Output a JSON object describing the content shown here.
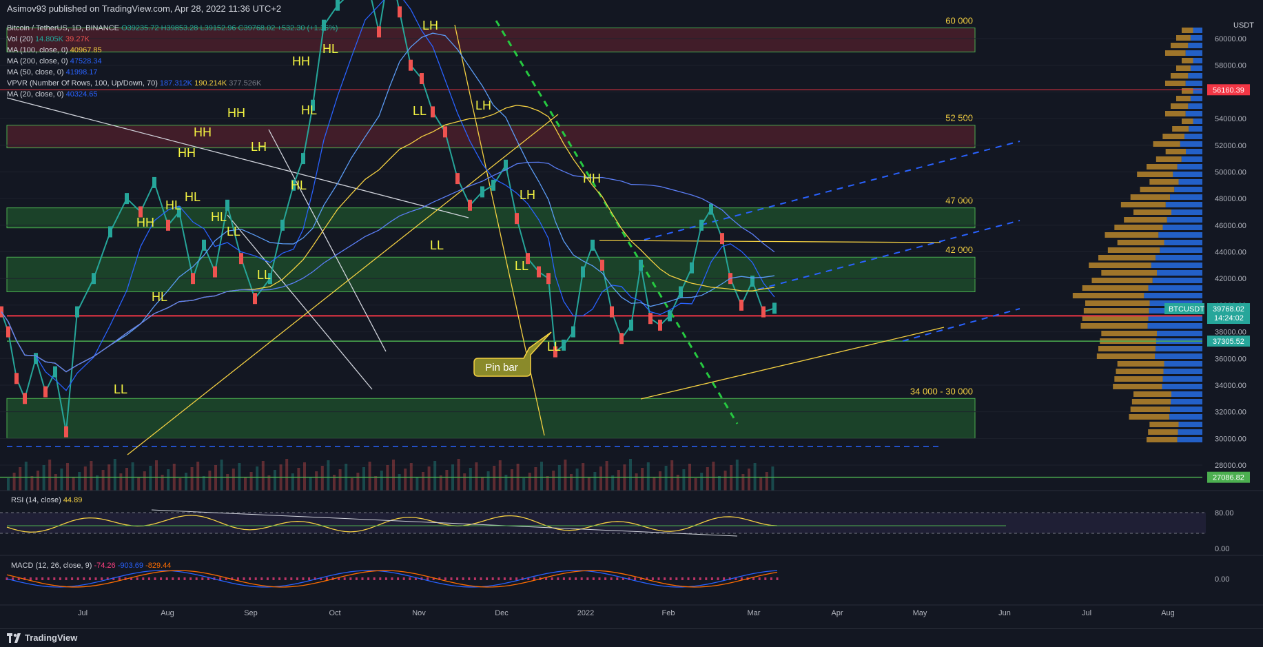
{
  "header": {
    "publisher": "Asimov93 published on TradingView.com, Apr 28, 2022 11:36 UTC+2"
  },
  "legend": {
    "symbol": "Bitcoin / TetherUS, 1D, BINANCE",
    "ohlc": "O39235.72 H39853.28 L39152.96 C39768.02 +532.30 (+1.36%)",
    "vol_label": "Vol (20)",
    "vol_v1": "14.805K",
    "vol_v2": "39.27K",
    "ma100_label": "MA (100, close, 0)",
    "ma100_value": "40967.85",
    "ma200_label": "MA (200, close, 0)",
    "ma200_value": "47528.34",
    "ma50_label": "MA (50, close, 0)",
    "ma50_value": "41998.17",
    "vpvr_label": "VPVR (Number Of Rows, 100, Up/Down, 70)",
    "vpvr_v1": "187.312K",
    "vpvr_v2": "190.214K",
    "vpvr_v3": "377.526K",
    "ma20_label": "MA (20, close, 0)",
    "ma20_value": "40324.65"
  },
  "rsi_legend": {
    "label": "RSI (14, close)",
    "value": "44.89"
  },
  "macd_legend": {
    "label": "MACD (12, 26, close, 9)",
    "v1": "-74.26",
    "v2": "-903.69",
    "v3": "-829.44"
  },
  "footer": {
    "brand": "TradingView"
  },
  "chart_data": {
    "type": "line",
    "symbol": "BTCUSDT",
    "currency": "USDT",
    "last_price": "39768.02",
    "countdown": "14:24:02",
    "price_labels": [
      "56160.39",
      "37305.52",
      "27086.82"
    ],
    "y_ticks": [
      "60000.00",
      "58000.00",
      "56000.00",
      "54000.00",
      "52000.00",
      "50000.00",
      "48000.00",
      "46000.00",
      "44000.00",
      "42000.00",
      "40000.00",
      "38000.00",
      "36000.00",
      "34000.00",
      "32000.00",
      "30000.00",
      "28000.00"
    ],
    "x_ticks": [
      "Jul",
      "Aug",
      "Sep",
      "Oct",
      "Nov",
      "Dec",
      "2022",
      "Feb",
      "Mar",
      "Apr",
      "May",
      "Jun",
      "Jul",
      "Aug"
    ],
    "rsi_ticks": [
      "80.00",
      "0.00"
    ],
    "macd_ticks": [
      "0.00"
    ],
    "zones": [
      {
        "label": "60 000",
        "low": 59000,
        "high": 60800,
        "color": "#4a1f2a"
      },
      {
        "label": "52 500",
        "low": 51800,
        "high": 53500,
        "color": "#4a1f2a"
      },
      {
        "label": "47 000",
        "low": 45800,
        "high": 47300,
        "color": "#1d4a2a"
      },
      {
        "label": "42 000",
        "low": 41000,
        "high": 43600,
        "color": "#1d4a2a"
      },
      {
        "label": "34 000 - 30 000",
        "low": 30000,
        "high": 33000,
        "color": "#1d4a2a"
      }
    ],
    "callout": "Pin bar",
    "annotations": [
      {
        "t": "HH",
        "x": 40,
        "y": 146
      },
      {
        "t": "HH",
        "x": 88,
        "y": 110
      },
      {
        "t": "HH",
        "x": 59,
        "y": 129
      },
      {
        "t": "HH",
        "x": 27,
        "y": 191
      },
      {
        "t": "HL",
        "x": 32,
        "y": 161
      },
      {
        "t": "HL",
        "x": 47,
        "y": 148
      },
      {
        "t": "HL",
        "x": 62,
        "y": 133
      },
      {
        "t": "HL",
        "x": 79,
        "y": 84
      },
      {
        "t": "HL",
        "x": 102,
        "y": 121
      },
      {
        "t": "LH",
        "x": 70,
        "y": 112
      },
      {
        "t": "LH",
        "x": 158,
        "y": 178
      },
      {
        "t": "LH",
        "x": 177,
        "y": 214
      },
      {
        "t": "LH",
        "x": 284,
        "y": 220
      },
      {
        "t": "HL",
        "x": 158,
        "y": 111
      },
      {
        "t": "HH",
        "x": 248,
        "y": 210
      },
      {
        "t": "HH",
        "x": 319,
        "y": 220
      },
      {
        "t": "LL",
        "x": 52,
        "y": 239
      },
      {
        "t": "LL",
        "x": 75,
        "y": 225
      },
      {
        "t": "LL",
        "x": 114,
        "y": 125
      },
      {
        "t": "LL",
        "x": 260,
        "y": 250
      },
      {
        "t": "LL",
        "x": 281,
        "y": 206
      },
      {
        "t": "LL",
        "x": 310,
        "y": 203
      },
      {
        "t": "HL",
        "x": 33,
        "y": 262
      }
    ],
    "price_path": [
      [
        2,
        39500
      ],
      [
        12,
        38000
      ],
      [
        24,
        34500
      ],
      [
        36,
        33000
      ],
      [
        52,
        36000
      ],
      [
        66,
        33500
      ],
      [
        80,
        35000
      ],
      [
        96,
        30500
      ],
      [
        112,
        39500
      ],
      [
        136,
        42000
      ],
      [
        160,
        45500
      ],
      [
        184,
        48000
      ],
      [
        204,
        47000
      ],
      [
        224,
        49200
      ],
      [
        244,
        46000
      ],
      [
        260,
        47000
      ],
      [
        280,
        42000
      ],
      [
        296,
        44500
      ],
      [
        312,
        42500
      ],
      [
        330,
        47500
      ],
      [
        350,
        43500
      ],
      [
        370,
        40500
      ],
      [
        392,
        42000
      ],
      [
        410,
        46000
      ],
      [
        426,
        49000
      ],
      [
        440,
        51000
      ],
      [
        454,
        55000
      ],
      [
        470,
        61000
      ],
      [
        490,
        62500
      ],
      [
        510,
        63500
      ],
      [
        530,
        65000
      ],
      [
        550,
        60500
      ],
      [
        566,
        65500
      ],
      [
        580,
        62000
      ],
      [
        596,
        58000
      ],
      [
        612,
        57000
      ],
      [
        628,
        54500
      ],
      [
        646,
        53000
      ],
      [
        664,
        49500
      ],
      [
        682,
        47500
      ],
      [
        700,
        48500
      ],
      [
        716,
        49000
      ],
      [
        734,
        50500
      ],
      [
        750,
        46500
      ],
      [
        766,
        43500
      ],
      [
        782,
        42500
      ],
      [
        796,
        42000
      ],
      [
        806,
        36500
      ],
      [
        818,
        37000
      ],
      [
        832,
        38000
      ],
      [
        846,
        42500
      ],
      [
        860,
        44500
      ],
      [
        874,
        43000
      ],
      [
        888,
        39500
      ],
      [
        902,
        37500
      ],
      [
        916,
        38500
      ],
      [
        930,
        43000
      ],
      [
        944,
        39000
      ],
      [
        958,
        38500
      ],
      [
        972,
        39200
      ],
      [
        988,
        41000
      ],
      [
        1004,
        42800
      ],
      [
        1018,
        46000
      ],
      [
        1032,
        47200
      ],
      [
        1048,
        45000
      ],
      [
        1060,
        42000
      ],
      [
        1076,
        40000
      ],
      [
        1092,
        41800
      ],
      [
        1108,
        39500
      ],
      [
        1124,
        39768
      ]
    ]
  }
}
